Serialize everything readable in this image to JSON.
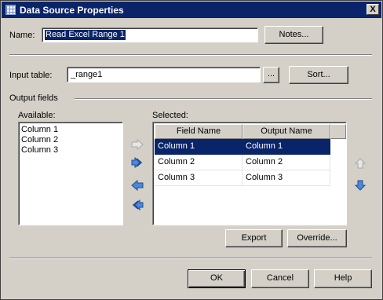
{
  "window": {
    "title": "Data Source Properties",
    "close_glyph": "X"
  },
  "name_label": "Name:",
  "name_value": "Read Excel Range 1",
  "notes_button": "Notes...",
  "input_table_label": "Input table:",
  "input_table_value": "_range1",
  "browse_button": "...",
  "sort_button": "Sort...",
  "output_fields_label": "Output fields",
  "available": {
    "label": "Available:",
    "items": [
      "Column 1",
      "Column 2",
      "Column 3"
    ]
  },
  "selected": {
    "label": "Selected:",
    "columns": [
      "Field Name",
      "Output Name"
    ],
    "rows": [
      {
        "field": "Column 1",
        "output": "Column 1",
        "selected": true
      },
      {
        "field": "Column 2",
        "output": "Column 2",
        "selected": false
      },
      {
        "field": "Column 3",
        "output": "Column 3",
        "selected": false
      }
    ]
  },
  "transfer_icons": [
    "move-right-icon",
    "move-all-right-icon",
    "move-left-icon",
    "move-all-left-icon"
  ],
  "order_icons": [
    "move-up-icon",
    "move-down-icon"
  ],
  "export_button": "Export",
  "override_button": "Override...",
  "ok_button": "OK",
  "cancel_button": "Cancel",
  "help_button": "Help",
  "colors": {
    "title_bar": "#0a246a",
    "selection": "#0a246a",
    "face": "#d4d0c8",
    "arrow_blue": "#3a78c8",
    "arrow_disabled": "#c0c0c0"
  }
}
